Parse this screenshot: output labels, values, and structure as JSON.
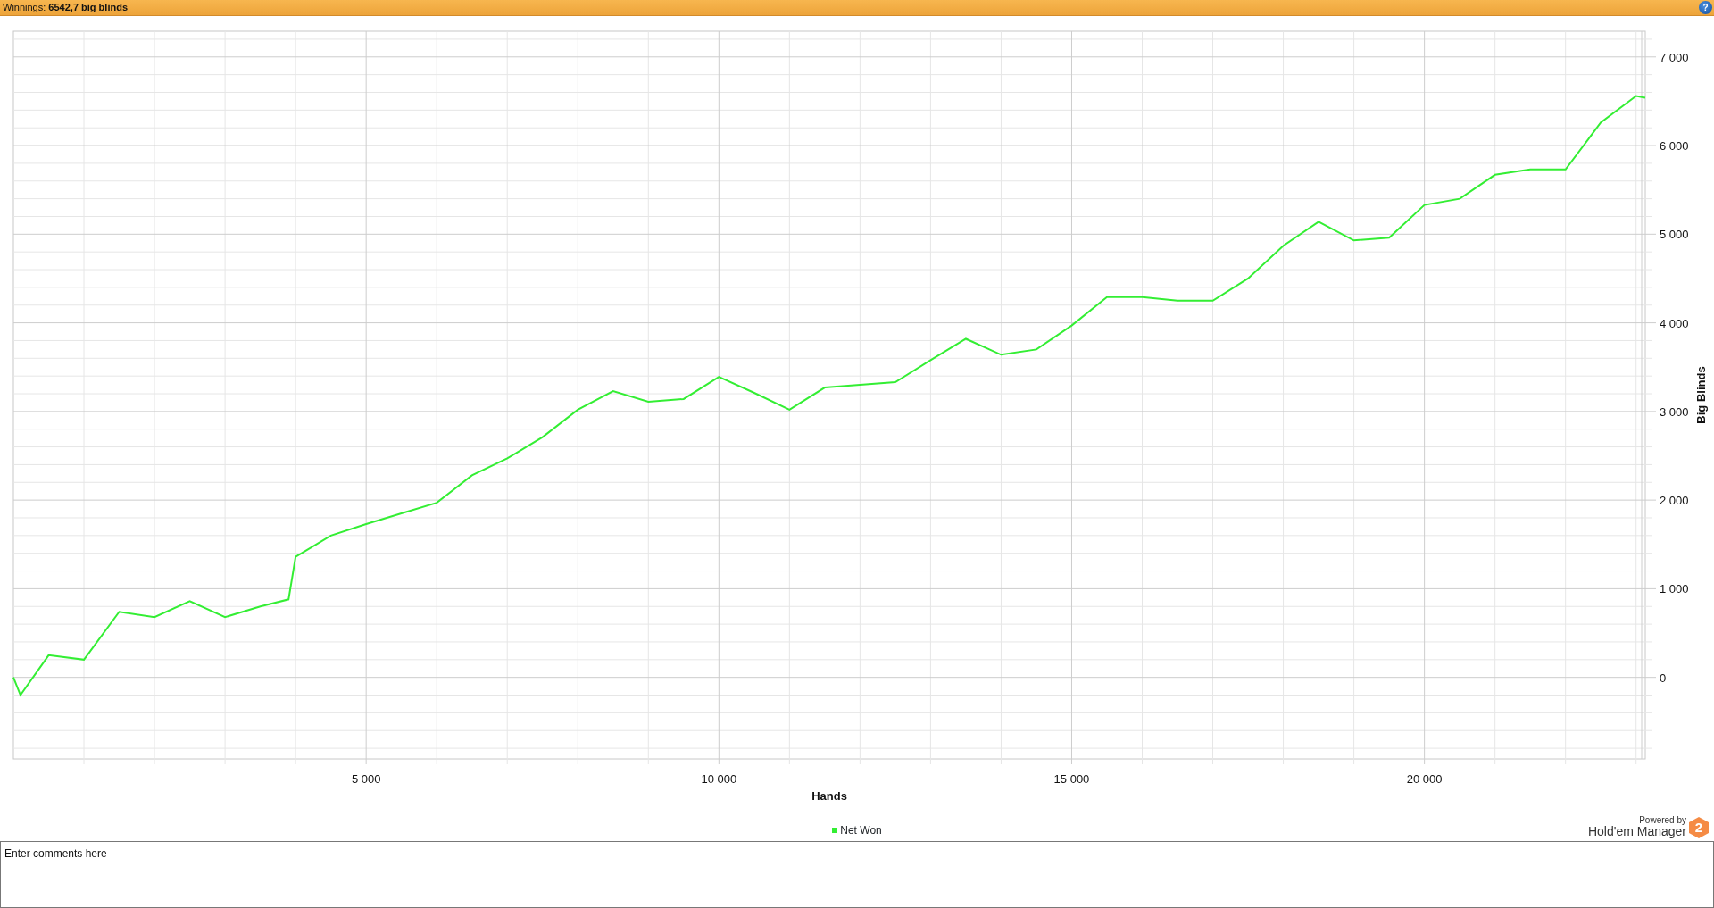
{
  "header": {
    "title": "Winnings: **6542,7 big blinds**",
    "help_button": "?"
  },
  "chart": {
    "chart_data": {
      "type": "line",
      "grid": true,
      "xlabel": "Hands",
      "ylabel": "Big Blinds",
      "xlim": [
        0,
        23130
      ],
      "ylim": [
        -920,
        7290
      ],
      "xticks": [
        {
          "value": 5000,
          "label": "5 000"
        },
        {
          "value": 10000,
          "label": "10 000"
        },
        {
          "value": 15000,
          "label": "15 000"
        },
        {
          "value": 20000,
          "label": "20 000"
        }
      ],
      "yticks": [
        {
          "value": 0,
          "label": "0"
        },
        {
          "value": 1000,
          "label": "1 000"
        },
        {
          "value": 2000,
          "label": "2 000"
        },
        {
          "value": 3000,
          "label": "3 000"
        },
        {
          "value": 4000,
          "label": "4 000"
        },
        {
          "value": 5000,
          "label": "5 000"
        },
        {
          "value": 6000,
          "label": "6 000"
        },
        {
          "value": 7000,
          "label": "7 000"
        }
      ],
      "x": [
        0,
        100,
        500,
        1000,
        1500,
        2000,
        2500,
        3000,
        3500,
        3900,
        4000,
        4500,
        5000,
        5500,
        6000,
        6500,
        7000,
        7500,
        8000,
        8500,
        9000,
        9500,
        10000,
        10500,
        11000,
        11500,
        12000,
        12500,
        13000,
        13500,
        14000,
        14500,
        15000,
        15500,
        16000,
        16500,
        17000,
        17500,
        18000,
        18500,
        19000,
        19500,
        20000,
        20500,
        21000,
        21500,
        22000,
        22500,
        23000,
        23130
      ],
      "series": [
        {
          "name": "Net Won",
          "color": "#33ee33",
          "values": [
            0,
            -200,
            250,
            200,
            740,
            680,
            860,
            680,
            800,
            880,
            1360,
            1600,
            1730,
            1850,
            1970,
            2280,
            2470,
            2710,
            3020,
            3230,
            3110,
            3140,
            3390,
            3210,
            3020,
            3270,
            3300,
            3330,
            3580,
            3820,
            3640,
            3700,
            3970,
            4290,
            4290,
            4250,
            4250,
            4500,
            4870,
            5140,
            4930,
            4960,
            5330,
            5400,
            5670,
            5730,
            5730,
            6260,
            6560,
            6540
          ]
        }
      ]
    }
  },
  "footer": {
    "powered_by": "Powered by",
    "product": "Hold'em Manager",
    "logo_mark": "2"
  },
  "comments": {
    "placeholder": "Enter comments here"
  }
}
